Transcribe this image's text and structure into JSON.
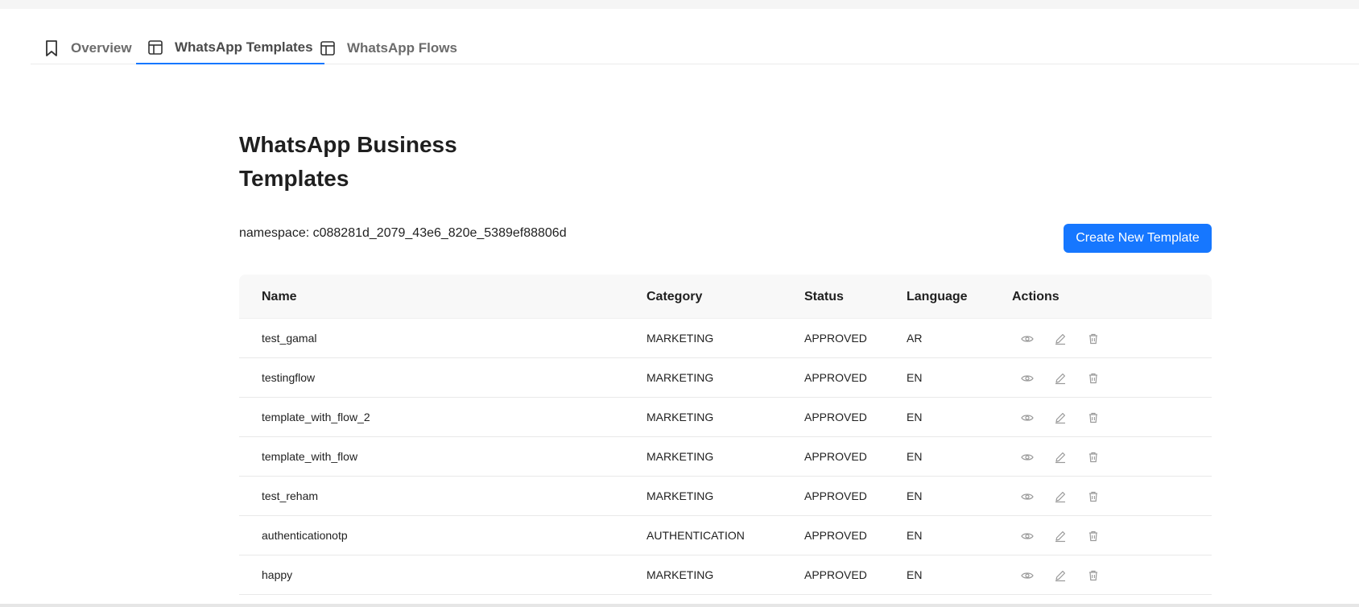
{
  "tabs": [
    {
      "label": "Overview",
      "icon": "bookmark-icon"
    },
    {
      "label": "WhatsApp Templates",
      "icon": "layout-icon",
      "active": true
    },
    {
      "label": "WhatsApp Flows",
      "icon": "layout-icon"
    }
  ],
  "page": {
    "title_line1": "WhatsApp Business",
    "title_line2": "Templates",
    "namespace": "namespace: c088281d_2079_43e6_820e_5389ef88806d",
    "create_button": "Create New Template"
  },
  "table": {
    "headers": {
      "name": "Name",
      "category": "Category",
      "status": "Status",
      "language": "Language",
      "actions": "Actions"
    },
    "rows": [
      {
        "name": "test_gamal",
        "category": "MARKETING",
        "status": "APPROVED",
        "language": "AR"
      },
      {
        "name": "testingflow",
        "category": "MARKETING",
        "status": "APPROVED",
        "language": "EN"
      },
      {
        "name": "template_with_flow_2",
        "category": "MARKETING",
        "status": "APPROVED",
        "language": "EN"
      },
      {
        "name": "template_with_flow",
        "category": "MARKETING",
        "status": "APPROVED",
        "language": "EN"
      },
      {
        "name": "test_reham",
        "category": "MARKETING",
        "status": "APPROVED",
        "language": "EN"
      },
      {
        "name": "authenticationotp",
        "category": "AUTHENTICATION",
        "status": "APPROVED",
        "language": "EN"
      },
      {
        "name": "happy",
        "category": "MARKETING",
        "status": "APPROVED",
        "language": "EN"
      }
    ]
  },
  "colors": {
    "accent": "#1677ff",
    "header_bg": "#f8f8f8",
    "icon_gray": "#9a9a9a"
  }
}
